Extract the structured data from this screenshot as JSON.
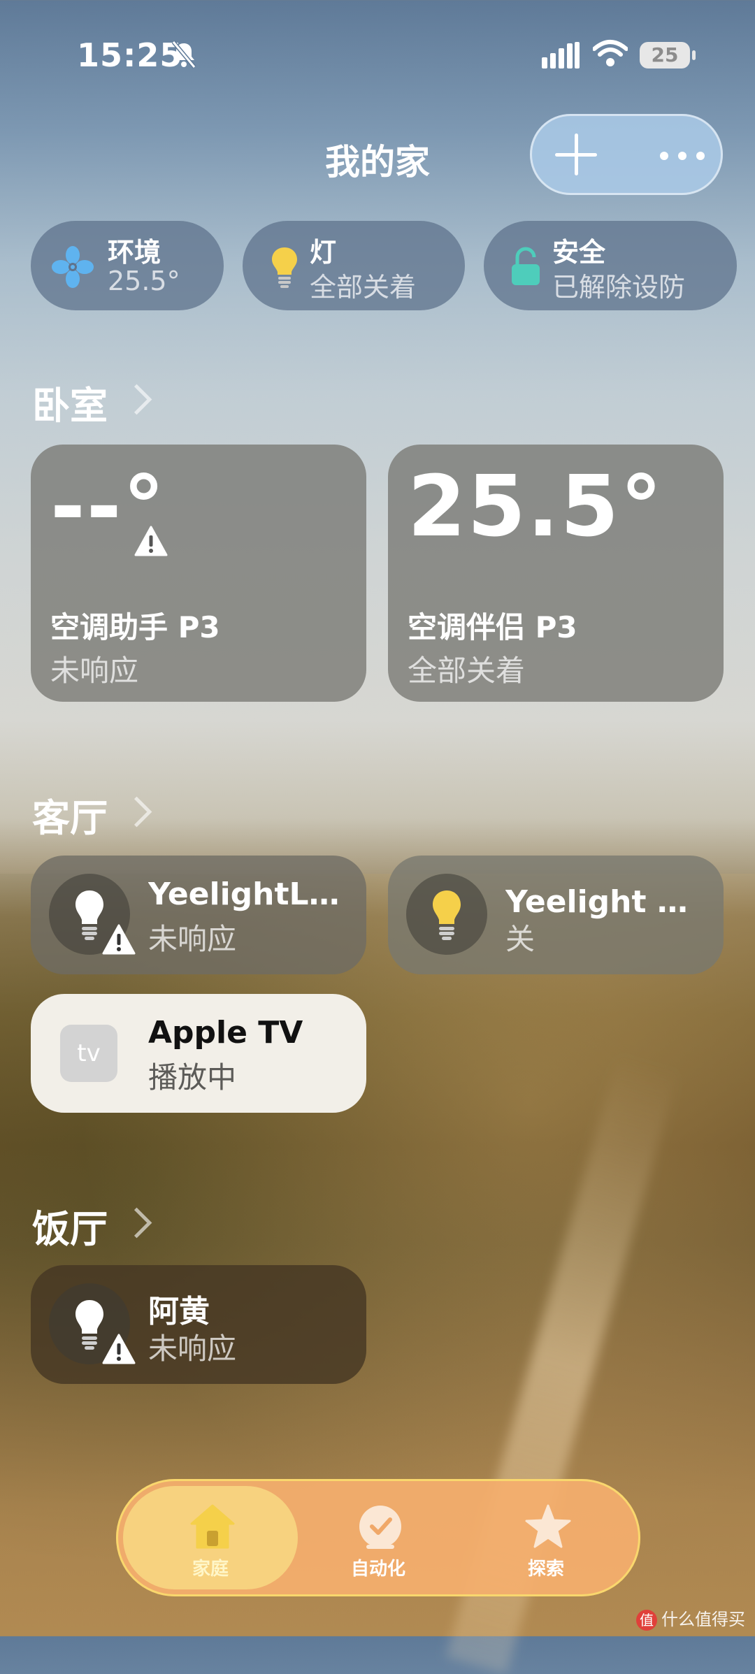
{
  "status_bar": {
    "time": "15:25",
    "battery": "25"
  },
  "header": {
    "title": "我的家"
  },
  "summary": [
    {
      "title": "环境",
      "value": "25.5°",
      "icon": "fan-icon",
      "color": "#5fb3ef"
    },
    {
      "title": "灯",
      "value": "全部关着",
      "icon": "bulb-icon",
      "color": "#f5d04a"
    },
    {
      "title": "安全",
      "value": "已解除设防",
      "icon": "lock-icon",
      "color": "#4ecdbb"
    }
  ],
  "sections": {
    "bedroom": {
      "title": "卧室",
      "tiles": [
        {
          "temp": "--°",
          "name": "空调助手 P3",
          "state": "未响应"
        },
        {
          "temp": "25.5°",
          "name": "空调伴侣 P3",
          "state": "全部关着"
        }
      ]
    },
    "living_room": {
      "title": "客厅",
      "tiles": [
        {
          "name": "YeelightLE…",
          "state": "未响应"
        },
        {
          "name": "Yeelight 氛…",
          "state": "关"
        },
        {
          "name": "Apple TV",
          "state": "播放中",
          "icon_text": "tv"
        }
      ]
    },
    "dining_room": {
      "title": "饭厅",
      "tiles": [
        {
          "name": "阿黄",
          "state": "未响应"
        }
      ]
    }
  },
  "tabbar": [
    {
      "label": "家庭",
      "icon": "home-icon",
      "active": true
    },
    {
      "label": "自动化",
      "icon": "clock-icon",
      "active": false
    },
    {
      "label": "探索",
      "icon": "star-icon",
      "active": false
    }
  ],
  "watermark": {
    "text": "什么值得买",
    "logo": "值"
  },
  "colors": {
    "accent_yellow": "#f5d04a",
    "tab_active": "#f7d27f",
    "tabbar": "#f5af6e"
  }
}
